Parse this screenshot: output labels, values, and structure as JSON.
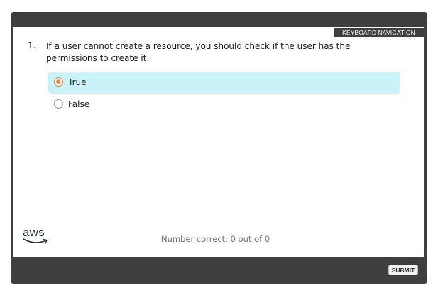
{
  "header": {
    "keyboard_navigation_label": "KEYBOARD NAVIGATION"
  },
  "question": {
    "number": "1.",
    "text": "If a user cannot create a resource, you should check if the user has the permissions to create it."
  },
  "options": [
    {
      "label": "True",
      "selected": true
    },
    {
      "label": "False",
      "selected": false
    }
  ],
  "footer": {
    "logo_text": "aws",
    "score_text": "Number correct: 0 out of 0",
    "submit_label": "SUBMIT"
  },
  "colors": {
    "frame": "#3f3f3f",
    "selected_option_bg": "#c9f3f8",
    "radio_checked": "#f08a3a",
    "aws_smile": "#232f3e"
  }
}
